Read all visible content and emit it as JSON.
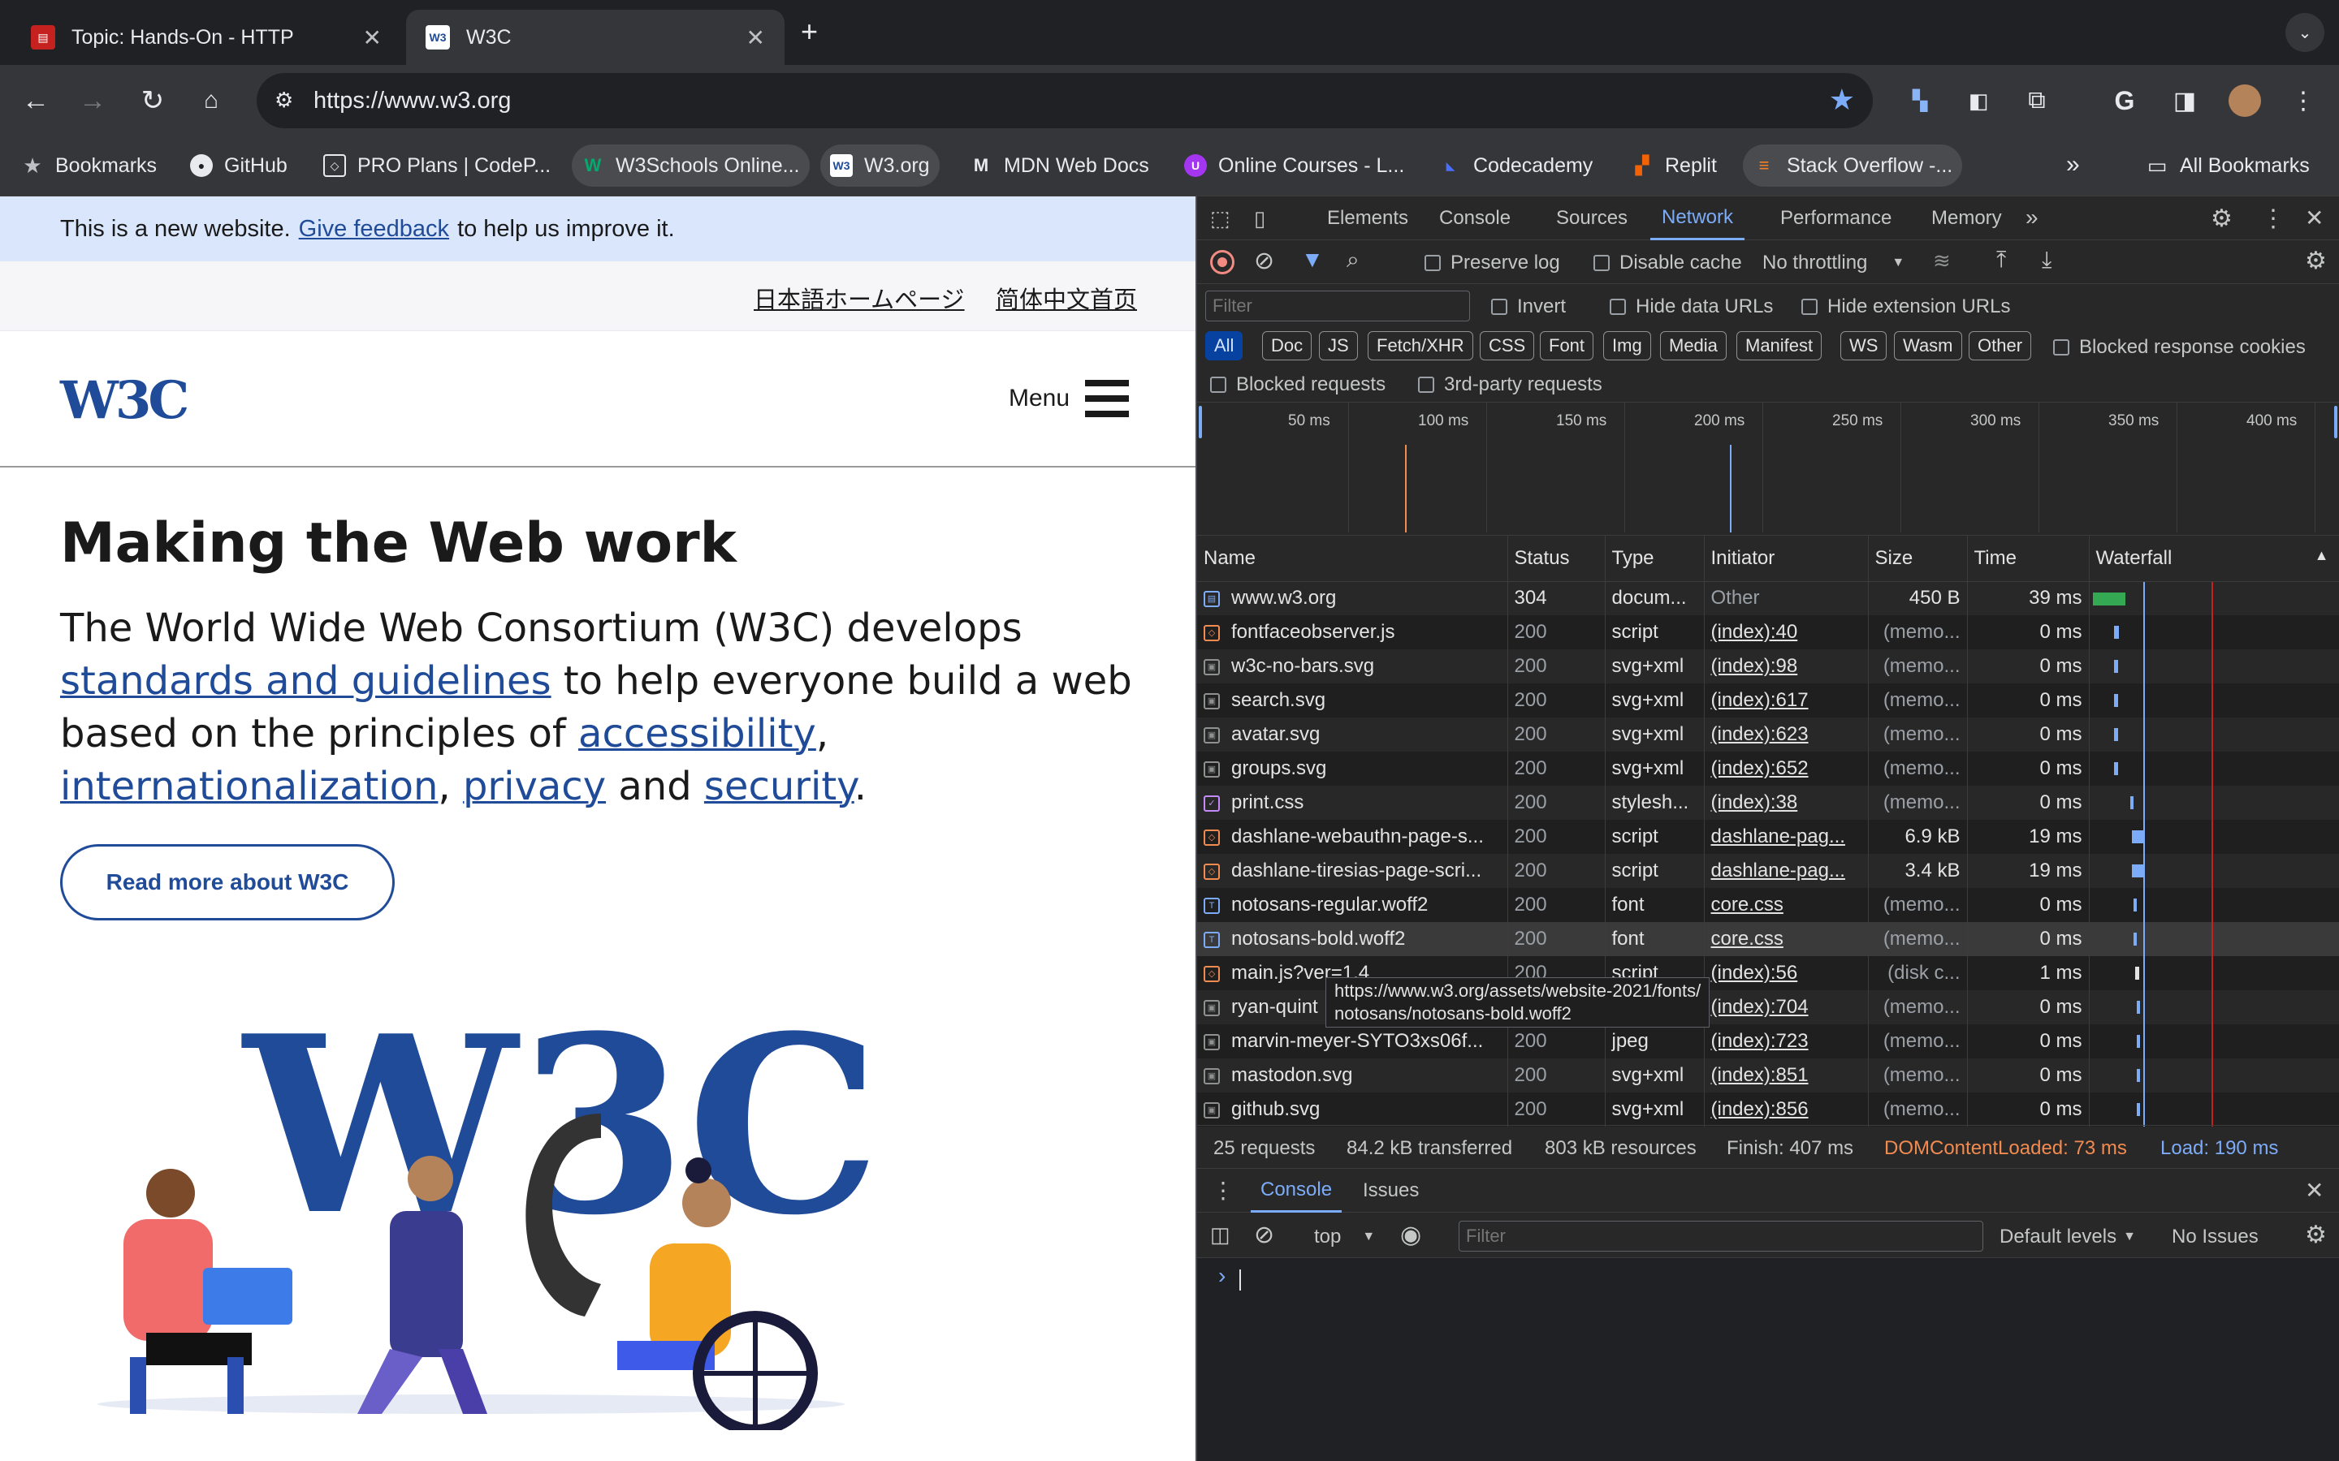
{
  "tabs": [
    {
      "title": "Topic: Hands-On - HTTP",
      "active": false
    },
    {
      "title": "W3C",
      "active": true
    }
  ],
  "toolbar": {
    "url": "https://www.w3.org"
  },
  "bookmarks": [
    {
      "label": "Bookmarks",
      "icon": "star-icon"
    },
    {
      "label": "GitHub",
      "icon": "github-icon"
    },
    {
      "label": "PRO Plans | CodeP...",
      "icon": "codepen-icon"
    },
    {
      "label": "W3Schools Online...",
      "icon": "w3schools-icon"
    },
    {
      "label": "W3.org",
      "icon": "w3-icon"
    },
    {
      "label": "MDN Web Docs",
      "icon": "mdn-icon"
    },
    {
      "label": "Online Courses - L...",
      "icon": "udemy-icon"
    },
    {
      "label": "Codecademy",
      "icon": "codecademy-icon"
    },
    {
      "label": "Replit",
      "icon": "replit-icon"
    },
    {
      "label": "Stack Overflow -...",
      "icon": "stackoverflow-icon"
    }
  ],
  "all_bookmarks": "All Bookmarks",
  "page": {
    "banner_text": "This is a new website.",
    "banner_link": "Give feedback",
    "banner_tail": "to help us improve it.",
    "lang_ja": "日本語ホームページ",
    "lang_zh": "简体中文首页",
    "logo_text": "W3C",
    "menu_label": "Menu",
    "heading": "Making the Web work",
    "intro_1": "The World Wide Web Consortium (W3C) develops ",
    "intro_link1": "standards and guidelines",
    "intro_2": " to help everyone build a web based on the principles of ",
    "intro_link2": "accessibility",
    "intro_sep1": ", ",
    "intro_link3": "internationalization",
    "intro_sep2": ", ",
    "intro_link4": "privacy",
    "intro_3": " and ",
    "intro_link5": "security",
    "intro_end": ".",
    "read_more": "Read more about W3C",
    "illustration_letters": "W3C"
  },
  "devtools": {
    "tabs": [
      "Elements",
      "Console",
      "Sources",
      "Network",
      "Performance",
      "Memory"
    ],
    "active_tab": "Network",
    "preserve_log": "Preserve log",
    "disable_cache": "Disable cache",
    "throttling": "No throttling",
    "filter_placeholder": "Filter",
    "invert": "Invert",
    "hide_data_urls": "Hide data URLs",
    "hide_ext_urls": "Hide extension URLs",
    "chips": [
      "All",
      "Doc",
      "JS",
      "Fetch/XHR",
      "CSS",
      "Font",
      "Img",
      "Media",
      "Manifest",
      "WS",
      "Wasm",
      "Other"
    ],
    "blocked_cookies": "Blocked response cookies",
    "blocked_requests": "Blocked requests",
    "third_party": "3rd-party requests",
    "ticks": [
      "50 ms",
      "100 ms",
      "150 ms",
      "200 ms",
      "250 ms",
      "300 ms",
      "350 ms",
      "400 ms"
    ],
    "columns": [
      "Name",
      "Status",
      "Type",
      "Initiator",
      "Size",
      "Time",
      "Waterfall"
    ],
    "rows": [
      {
        "name": "www.w3.org",
        "status": "304",
        "type": "docum...",
        "initiator": "Other",
        "size": "450 B",
        "time": "39 ms",
        "icon": "document-icon"
      },
      {
        "name": "fontfaceobserver.js",
        "status": "200",
        "type": "script",
        "initiator": "(index):40",
        "size": "(memo...",
        "time": "0 ms",
        "icon": "script-icon"
      },
      {
        "name": "w3c-no-bars.svg",
        "status": "200",
        "type": "svg+xml",
        "initiator": "(index):98",
        "size": "(memo...",
        "time": "0 ms",
        "icon": "image-icon"
      },
      {
        "name": "search.svg",
        "status": "200",
        "type": "svg+xml",
        "initiator": "(index):617",
        "size": "(memo...",
        "time": "0 ms",
        "icon": "image-icon"
      },
      {
        "name": "avatar.svg",
        "status": "200",
        "type": "svg+xml",
        "initiator": "(index):623",
        "size": "(memo...",
        "time": "0 ms",
        "icon": "image-icon"
      },
      {
        "name": "groups.svg",
        "status": "200",
        "type": "svg+xml",
        "initiator": "(index):652",
        "size": "(memo...",
        "time": "0 ms",
        "icon": "image-icon"
      },
      {
        "name": "print.css",
        "status": "200",
        "type": "stylesh...",
        "initiator": "(index):38",
        "size": "(memo...",
        "time": "0 ms",
        "icon": "stylesheet-icon"
      },
      {
        "name": "dashlane-webauthn-page-s...",
        "status": "200",
        "type": "script",
        "initiator": "dashlane-pag...",
        "size": "6.9 kB",
        "time": "19 ms",
        "icon": "script-icon"
      },
      {
        "name": "dashlane-tiresias-page-scri...",
        "status": "200",
        "type": "script",
        "initiator": "dashlane-pag...",
        "size": "3.4 kB",
        "time": "19 ms",
        "icon": "script-icon"
      },
      {
        "name": "notosans-regular.woff2",
        "status": "200",
        "type": "font",
        "initiator": "core.css",
        "size": "(memo...",
        "time": "0 ms",
        "icon": "font-icon"
      },
      {
        "name": "notosans-bold.woff2",
        "status": "200",
        "type": "font",
        "initiator": "core.css",
        "size": "(memo...",
        "time": "0 ms",
        "icon": "font-icon"
      },
      {
        "name": "main.js?ver=1.4",
        "status": "200",
        "type": "script",
        "initiator": "(index):56",
        "size": "(disk c...",
        "time": "1 ms",
        "icon": "script-icon"
      },
      {
        "name": "ryan-quint",
        "status": "200",
        "type": "svg+xml",
        "initiator": "(index):704",
        "size": "(memo...",
        "time": "0 ms",
        "icon": "image-icon"
      },
      {
        "name": "marvin-meyer-SYTO3xs06f...",
        "status": "200",
        "type": "jpeg",
        "initiator": "(index):723",
        "size": "(memo...",
        "time": "0 ms",
        "icon": "image-icon"
      },
      {
        "name": "mastodon.svg",
        "status": "200",
        "type": "svg+xml",
        "initiator": "(index):851",
        "size": "(memo...",
        "time": "0 ms",
        "icon": "image-icon"
      },
      {
        "name": "github.svg",
        "status": "200",
        "type": "svg+xml",
        "initiator": "(index):856",
        "size": "(memo...",
        "time": "0 ms",
        "icon": "image-icon"
      }
    ],
    "tooltip": "https://www.w3.org/assets/website-2021/fonts/\nnotosans/notosans-bold.woff2",
    "summary": {
      "requests": "25 requests",
      "transferred": "84.2 kB transferred",
      "resources": "803 kB resources",
      "finish": "Finish: 407 ms",
      "dcl": "DOMContentLoaded: 73 ms",
      "load": "Load: 190 ms"
    },
    "drawer_tabs": [
      "Console",
      "Issues"
    ],
    "context": "top",
    "console_filter": "Filter",
    "levels": "Default levels",
    "issues": "No Issues",
    "colors": {
      "accent": "#7cacf8",
      "dcl": "#f28b50",
      "load": "#7cacf8"
    }
  }
}
